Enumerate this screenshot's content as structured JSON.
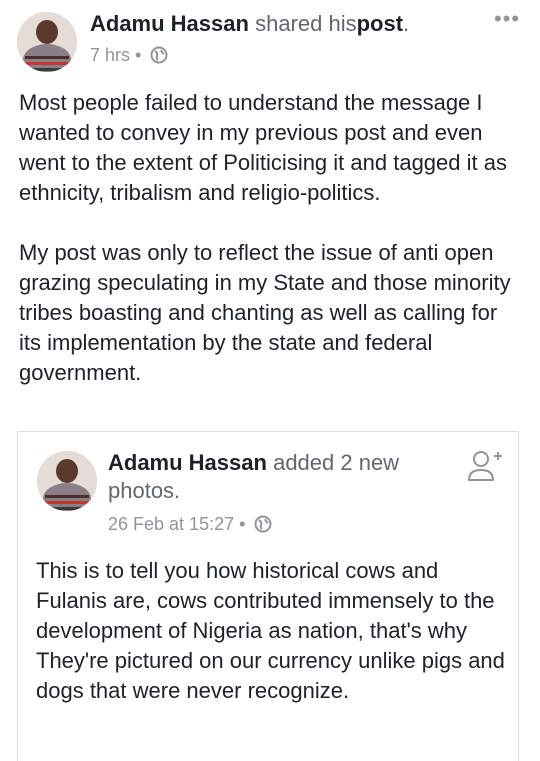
{
  "post": {
    "author": "Adamu Hassan",
    "action_pre": "shared his",
    "action_object": "post",
    "action_post": ".",
    "time": "7 hrs",
    "separator": "•",
    "more": "•••",
    "privacy_icon": "globe-icon",
    "paragraphs": [
      "Most people failed to understand the message I wanted to convey in my previous post and even  went to the extent of Politicising it and tagged it as ethnicity, tribalism and religio-politics.",
      "My post was only to reflect the issue of  anti open grazing speculating in my State and those minority tribes boasting and chanting as well as calling for its implementation by the state and federal government."
    ]
  },
  "shared": {
    "author": "Adamu Hassan",
    "action": "added 2 new photos.",
    "time": "26 Feb at 15:27",
    "separator": "•",
    "privacy_icon": "globe-icon",
    "add_friend_icon": "add-friend-icon",
    "body": "This is to tell you how historical cows and Fulanis are,  cows contributed immensely to the development of Nigeria as nation, that's why They're  pictured on our currency unlike pigs and dogs that were never recognize."
  },
  "colors": {
    "text": "#1d2129",
    "muted": "#616770",
    "meta": "#90949c",
    "border": "#dddfe2"
  }
}
